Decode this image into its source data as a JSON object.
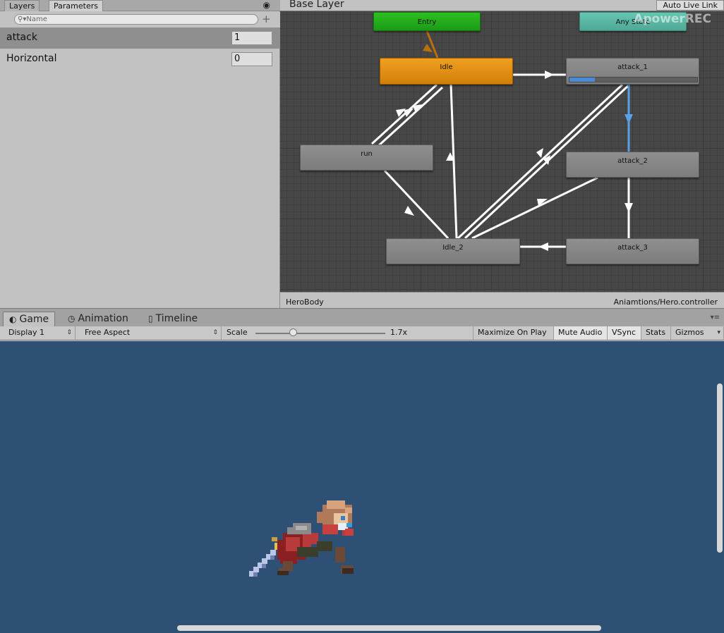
{
  "params_panel": {
    "tabs": [
      "Layers",
      "Parameters"
    ],
    "search_placeholder": "Name",
    "params": [
      {
        "name": "attack",
        "value": "1"
      },
      {
        "name": "Horizontal",
        "value": "0"
      }
    ]
  },
  "graph": {
    "title": "Base Layer",
    "auto_live_link": "Auto Live Link",
    "watermark": "ApowerREC",
    "nodes": {
      "entry": "Entry",
      "any_state": "Any State",
      "idle": "Idle",
      "attack_1": "attack_1",
      "run": "run",
      "attack_2": "attack_2",
      "idle_2": "Idle_2",
      "attack_3": "attack_3"
    },
    "attack_1_progress": 0.2,
    "footer_left": "HeroBody",
    "footer_right": "Aniamtions/Hero.controller"
  },
  "game_panel": {
    "tabs": [
      "Game",
      "Animation",
      "Timeline"
    ],
    "toolbar": {
      "display": "Display 1",
      "aspect": "Free Aspect",
      "scale_label": "Scale",
      "scale_value": "1.7x",
      "maximize": "Maximize On Play",
      "mute": "Mute Audio",
      "vsync": "VSync",
      "stats": "Stats",
      "gizmos": "Gizmos"
    }
  },
  "colors": {
    "entry": "#24a81c",
    "any_state": "#58b6a2",
    "idle": "#e08c0a",
    "active_transition": "#5aa0e6",
    "game_bg": "#2f5075"
  }
}
